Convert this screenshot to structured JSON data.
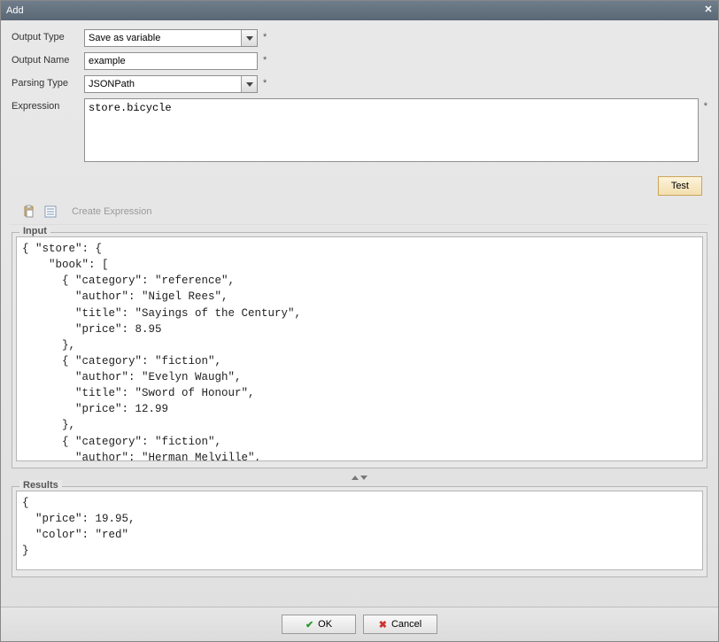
{
  "window": {
    "title": "Add"
  },
  "labels": {
    "output_type": "Output Type",
    "output_name": "Output Name",
    "parsing_type": "Parsing Type",
    "expression": "Expression",
    "required": "*"
  },
  "fields": {
    "output_type": {
      "value": "Save as variable"
    },
    "output_name": {
      "value": "example"
    },
    "parsing_type": {
      "value": "JSONPath"
    },
    "expression": {
      "value": "store.bicycle"
    }
  },
  "buttons": {
    "test": "Test",
    "ok": "OK",
    "cancel": "Cancel"
  },
  "toolbar": {
    "create_expression": "Create Expression"
  },
  "groups": {
    "input_legend": "Input",
    "results_legend": "Results"
  },
  "input_text": "{ \"store\": {\n    \"book\": [ \n      { \"category\": \"reference\",\n        \"author\": \"Nigel Rees\",\n        \"title\": \"Sayings of the Century\",\n        \"price\": 8.95\n      },\n      { \"category\": \"fiction\",\n        \"author\": \"Evelyn Waugh\",\n        \"title\": \"Sword of Honour\",\n        \"price\": 12.99\n      },\n      { \"category\": \"fiction\",\n        \"author\": \"Herman Melville\",",
  "results_text": "{\n  \"price\": 19.95,\n  \"color\": \"red\"\n}"
}
